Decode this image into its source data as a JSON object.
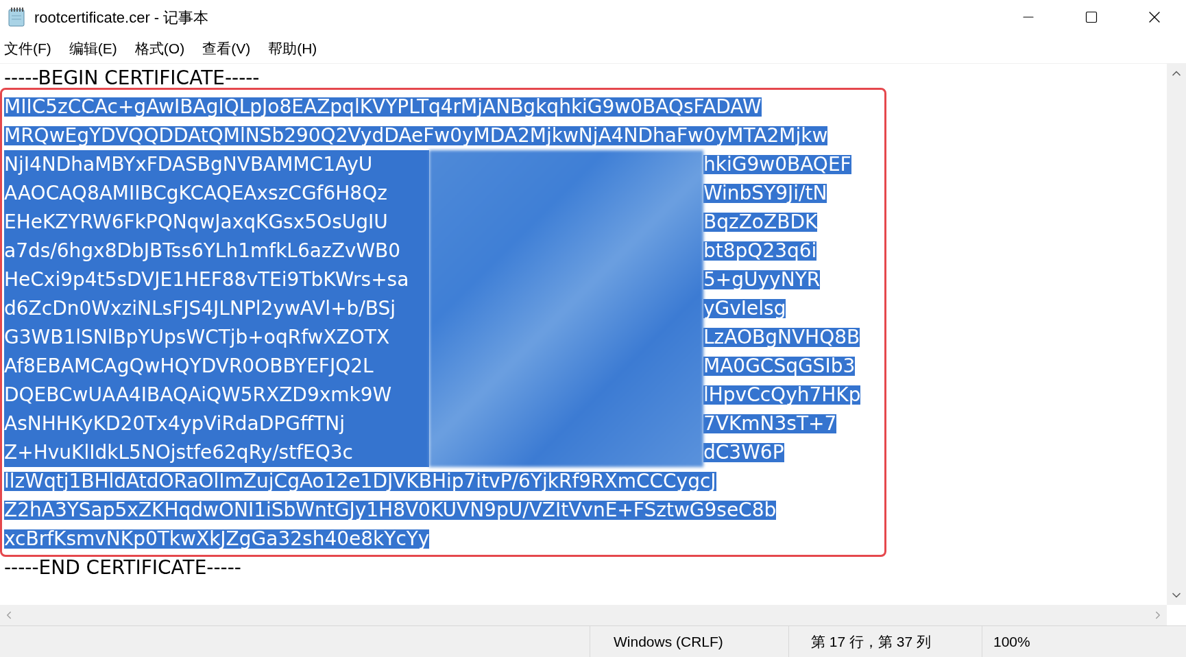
{
  "window": {
    "title": "rootcertificate.cer - 记事本"
  },
  "menu": [
    "文件(F)",
    "编辑(E)",
    "格式(O)",
    "查看(V)",
    "帮助(H)"
  ],
  "editor": {
    "lines": [
      {
        "kind": "full",
        "text": "-----BEGIN CERTIFICATE-----",
        "selected": false
      },
      {
        "kind": "full",
        "text": "MIIC5zCCAc+gAwIBAgIQLpJo8EAZpqlKVYPLTq4rMjANBgkqhkiG9w0BAQsFADAW",
        "selected": true
      },
      {
        "kind": "full",
        "text": "MRQwEgYDVQQDDAtQMlNSb290Q2VydDAeFw0yMDA2MjkwNjA4NDhaFw0yMTA2Mjkw",
        "selected": true
      },
      {
        "kind": "obscured",
        "left": "NjI4NDhaMBYxFDASBgNVBAMMC1AyU",
        "right": "hkiG9w0BAQEF",
        "selected": true
      },
      {
        "kind": "obscured",
        "left": "AAOCAQ8AMIIBCgKCAQEAxszCGf6H8Qz",
        "right": "WinbSY9Ji/tN",
        "selected": true
      },
      {
        "kind": "obscured",
        "left": "EHeKZYRW6FkPQNqwJaxqKGsx5OsUgIU",
        "right": "BqzZoZBDK",
        "selected": true
      },
      {
        "kind": "obscured",
        "left": "a7ds/6hgx8DbJBTss6YLh1mfkL6azZvWB0",
        "right": "bt8pQ23q6i",
        "selected": true
      },
      {
        "kind": "obscured",
        "left": "HeCxi9p4t5sDVJE1HEF88vTEi9TbKWrs+sa",
        "right": "5+gUyyNYR",
        "selected": true
      },
      {
        "kind": "obscured",
        "left": "d6ZcDn0WxziNLsFJS4JLNPl2ywAVl+b/BSj",
        "right": "yGvIelsg",
        "selected": true
      },
      {
        "kind": "obscured",
        "left": "G3WB1lSNlBpYUpsWCTjb+oqRfwXZOTX",
        "right": "LzAOBgNVHQ8B",
        "selected": true
      },
      {
        "kind": "obscured",
        "left": "Af8EBAMCAgQwHQYDVR0OBBYEFJQ2L",
        "right": "MA0GCSqGSIb3",
        "selected": true
      },
      {
        "kind": "obscured",
        "left": "DQEBCwUAA4IBAQAiQW5RXZD9xmk9W",
        "right": "lHpvCcQyh7HKp",
        "selected": true
      },
      {
        "kind": "obscured",
        "left": "AsNHHKyKD20Tx4ypViRdaDPGffTNj",
        "right": "7VKmN3sT+7",
        "selected": true
      },
      {
        "kind": "obscured",
        "left": "Z+HvuKlIdkL5NOjstfe62qRy/stfEQ3c",
        "right": "dC3W6P",
        "selected": true
      },
      {
        "kind": "full",
        "text": "llzWqtj1BHldAtdORaOlImZujCgAo12e1DJVKBHip7itvP/6YjkRf9RXmCCCygcJ",
        "selected": true
      },
      {
        "kind": "full",
        "text": "Z2hA3YSap5xZKHqdwONI1iSbWntGJy1H8V0KUVN9pU/VZItVvnE+FSztwG9seC8b",
        "selected": true
      },
      {
        "kind": "full",
        "text": "xcBrfKsmvNKp0TkwXkJZgGa32sh40e8kYcYy",
        "selected": true
      },
      {
        "kind": "full",
        "text": "-----END CERTIFICATE-----",
        "selected": false
      }
    ]
  },
  "status_bar": {
    "line_ending": "Windows (CRLF)",
    "position": "第 17 行，第 37 列",
    "zoom": "100%"
  }
}
